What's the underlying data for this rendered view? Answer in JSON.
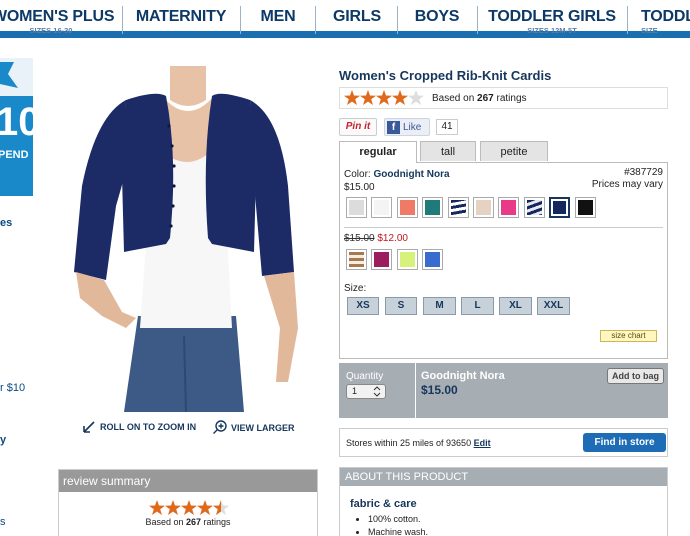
{
  "nav": {
    "items": [
      {
        "label": "WOMEN'S PLUS",
        "sub": "SIZES 16-30"
      },
      {
        "label": "MATERNITY",
        "sub": ""
      },
      {
        "label": "MEN",
        "sub": ""
      },
      {
        "label": "GIRLS",
        "sub": ""
      },
      {
        "label": "BOYS",
        "sub": ""
      },
      {
        "label": "TODDLER GIRLS",
        "sub": "SIZES 12M-5T"
      },
      {
        "label": "TODDL",
        "sub": "SIZE"
      }
    ]
  },
  "promo": {
    "big": "10",
    "small": "PEND"
  },
  "left_fragments": [
    "es",
    "r $10",
    "y",
    "s"
  ],
  "zoom": {
    "roll": "ROLL ON TO ZOOM IN",
    "larger": "VIEW LARGER"
  },
  "review_summary": {
    "title": "review summary",
    "based_prefix": "Based on",
    "count": "267",
    "based_suffix": "ratings"
  },
  "product": {
    "title": "Women's Cropped Rib-Knit Cardis",
    "rating": {
      "based_prefix": "Based on",
      "count": "267",
      "based_suffix": "ratings"
    },
    "pinit": "Pin it",
    "like": "Like",
    "like_count": "41",
    "tabs": [
      "regular",
      "tall",
      "petite"
    ],
    "color_label": "Color:",
    "color_name": "Goodnight Nora",
    "price": "$15.00",
    "sku": "#387729",
    "prices_note": "Prices may vary",
    "swatches_regular": [
      "#dcdcdc",
      "#f4f4f6",
      "#f07a66",
      "#1f7a7a",
      "stripe-navy",
      "#e6d2c2",
      "#e83a86",
      "stripe-navy2",
      "#16275e",
      "#111111"
    ],
    "old_price": "$15.00",
    "sale_price": "$12.00",
    "swatches_sale": [
      "stripe-tan",
      "#9b1d5e",
      "#d7f27a",
      "#3a6ccf"
    ],
    "size_label": "Size:",
    "sizes": [
      "XS",
      "S",
      "M",
      "L",
      "XL",
      "XXL"
    ],
    "size_chart": "size chart"
  },
  "buy": {
    "qty_label": "Quantity",
    "qty_value": "1",
    "color_name": "Goodnight Nora",
    "price": "$15.00",
    "add_to_bag": "Add to bag"
  },
  "stores": {
    "text": "Stores within 25 miles of 93650",
    "edit": "Edit",
    "find": "Find in store"
  },
  "about": {
    "title": "ABOUT THIS PRODUCT",
    "section": "fabric & care",
    "bullets": [
      "100% cotton.",
      "Machine wash."
    ]
  }
}
